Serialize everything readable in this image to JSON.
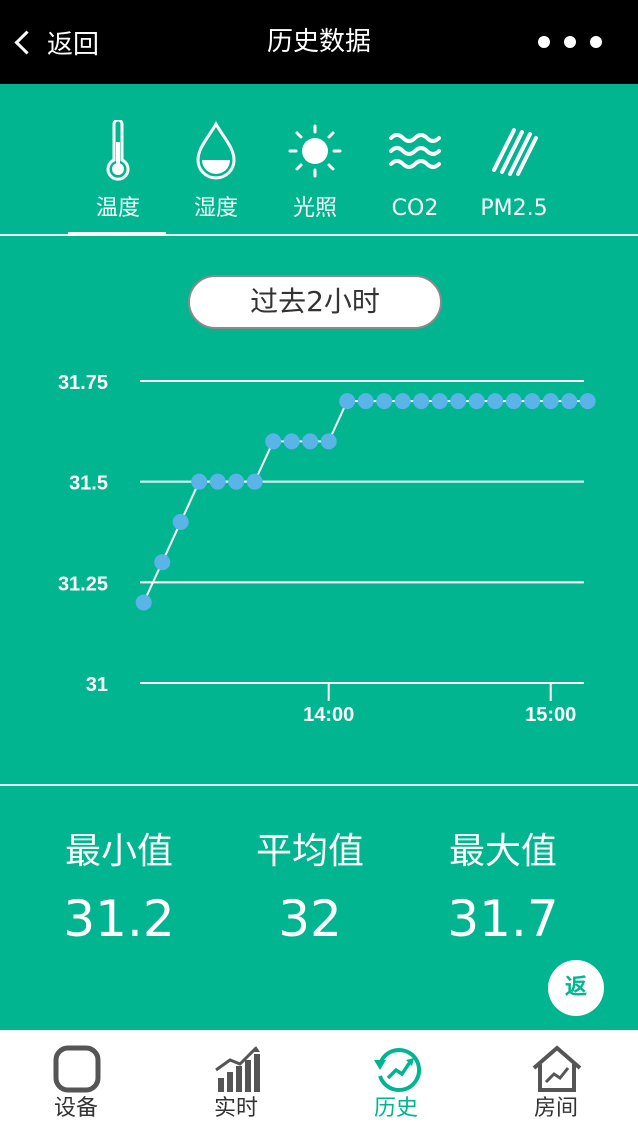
{
  "header": {
    "back_label": "返回",
    "title": "历史数据"
  },
  "tabs": [
    {
      "label": "温度",
      "icon": "thermometer-icon"
    },
    {
      "label": "湿度",
      "icon": "water-drop-icon"
    },
    {
      "label": "光照",
      "icon": "sun-icon"
    },
    {
      "label": "CO2",
      "icon": "waves-icon"
    },
    {
      "label": "PM2.5",
      "icon": "stripes-icon"
    }
  ],
  "selected_tab": "温度",
  "time_range": "过去2小时",
  "chart_data": {
    "type": "line",
    "y_ticks": [
      "31",
      "31.25",
      "31.5",
      "31.75"
    ],
    "x_ticks": [
      "14:00",
      "15:00"
    ],
    "ylim": [
      31,
      31.75
    ],
    "xlim": [
      "13:09",
      "15:09"
    ],
    "grid": true,
    "point_color": "#5ab4e8",
    "series": [
      {
        "x": [
          "13:10",
          "13:15",
          "13:20",
          "13:25",
          "13:30",
          "13:35",
          "13:40",
          "13:45",
          "13:50",
          "13:55",
          "14:00",
          "14:05",
          "14:10",
          "14:15",
          "14:20",
          "14:25",
          "14:30",
          "14:35",
          "14:40",
          "14:45",
          "14:50",
          "14:55",
          "15:00",
          "15:05",
          "15:10"
        ],
        "values": [
          31.2,
          31.3,
          31.4,
          31.5,
          31.5,
          31.5,
          31.5,
          31.6,
          31.6,
          31.6,
          31.6,
          31.7,
          31.7,
          31.7,
          31.7,
          31.7,
          31.7,
          31.7,
          31.7,
          31.7,
          31.7,
          31.7,
          31.7,
          31.7,
          31.7
        ]
      }
    ]
  },
  "stats": [
    {
      "name": "最小值",
      "value": "31.2"
    },
    {
      "name": "平均值",
      "value": "32"
    },
    {
      "name": "最大值",
      "value": "31.7"
    }
  ],
  "return_button_label": "返",
  "tabbar": [
    {
      "label": "设备",
      "icon": "device-icon"
    },
    {
      "label": "实时",
      "icon": "realtime-chart-icon"
    },
    {
      "label": "历史",
      "icon": "history-icon",
      "active": true
    },
    {
      "label": "房间",
      "icon": "room-house-icon"
    }
  ],
  "colors": {
    "accent": "#00b590",
    "header_bg": "#000000",
    "data_point": "#5ab4e8"
  }
}
